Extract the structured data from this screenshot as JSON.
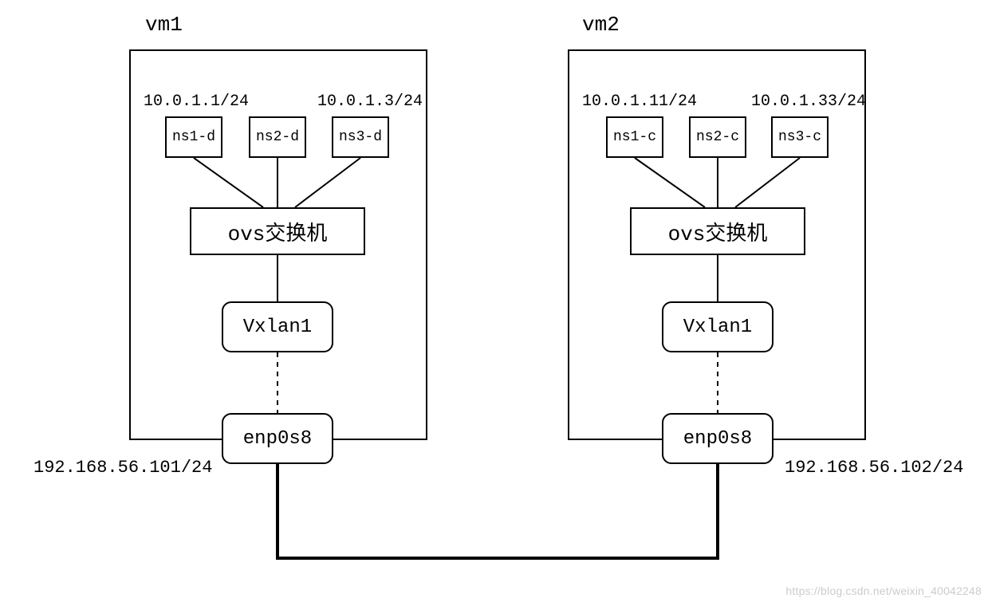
{
  "vm1": {
    "title": "vm1",
    "ip_ns1": "10.0.1.1/24",
    "ip_ns3": "10.0.1.3/24",
    "ns1": "ns1-d",
    "ns2": "ns2-d",
    "ns3": "ns3-d",
    "ovs": "ovs交换机",
    "vxlan": "Vxlan1",
    "enp": "enp0s8",
    "host_ip": "192.168.56.101/24"
  },
  "vm2": {
    "title": "vm2",
    "ip_ns1": "10.0.1.11/24",
    "ip_ns3": "10.0.1.33/24",
    "ns1": "ns1-c",
    "ns2": "ns2-c",
    "ns3": "ns3-c",
    "ovs": "ovs交换机",
    "vxlan": "Vxlan1",
    "enp": "enp0s8",
    "host_ip": "192.168.56.102/24"
  },
  "watermark": "https://blog.csdn.net/weixin_40042248",
  "chart_data": {
    "type": "diagram",
    "description": "Two-VM VXLAN overlay network topology",
    "nodes": [
      {
        "id": "vm1",
        "type": "host",
        "label": "vm1",
        "nic": "enp0s8",
        "nic_ip": "192.168.56.101/24",
        "children": [
          {
            "id": "ns1-d",
            "type": "netns",
            "ip": "10.0.1.1/24"
          },
          {
            "id": "ns2-d",
            "type": "netns",
            "ip": null
          },
          {
            "id": "ns3-d",
            "type": "netns",
            "ip": "10.0.1.3/24"
          },
          {
            "id": "ovs1",
            "type": "ovs-switch",
            "label": "ovs交换机"
          },
          {
            "id": "vxlan1-vm1",
            "type": "vxlan-iface",
            "label": "Vxlan1"
          }
        ]
      },
      {
        "id": "vm2",
        "type": "host",
        "label": "vm2",
        "nic": "enp0s8",
        "nic_ip": "192.168.56.102/24",
        "children": [
          {
            "id": "ns1-c",
            "type": "netns",
            "ip": "10.0.1.11/24"
          },
          {
            "id": "ns2-c",
            "type": "netns",
            "ip": null
          },
          {
            "id": "ns3-c",
            "type": "netns",
            "ip": "10.0.1.33/24"
          },
          {
            "id": "ovs2",
            "type": "ovs-switch",
            "label": "ovs交换机"
          },
          {
            "id": "vxlan1-vm2",
            "type": "vxlan-iface",
            "label": "Vxlan1"
          }
        ]
      }
    ],
    "edges": [
      {
        "from": "ns1-d",
        "to": "ovs1",
        "style": "solid"
      },
      {
        "from": "ns2-d",
        "to": "ovs1",
        "style": "solid"
      },
      {
        "from": "ns3-d",
        "to": "ovs1",
        "style": "solid"
      },
      {
        "from": "ovs1",
        "to": "vxlan1-vm1",
        "style": "solid"
      },
      {
        "from": "vxlan1-vm1",
        "to": "vm1.enp0s8",
        "style": "dashed"
      },
      {
        "from": "ns1-c",
        "to": "ovs2",
        "style": "solid"
      },
      {
        "from": "ns2-c",
        "to": "ovs2",
        "style": "solid"
      },
      {
        "from": "ns3-c",
        "to": "ovs2",
        "style": "solid"
      },
      {
        "from": "ovs2",
        "to": "vxlan1-vm2",
        "style": "solid"
      },
      {
        "from": "vxlan1-vm2",
        "to": "vm2.enp0s8",
        "style": "dashed"
      },
      {
        "from": "vm1.enp0s8",
        "to": "vm2.enp0s8",
        "style": "solid-heavy",
        "note": "physical underlay link"
      }
    ]
  }
}
